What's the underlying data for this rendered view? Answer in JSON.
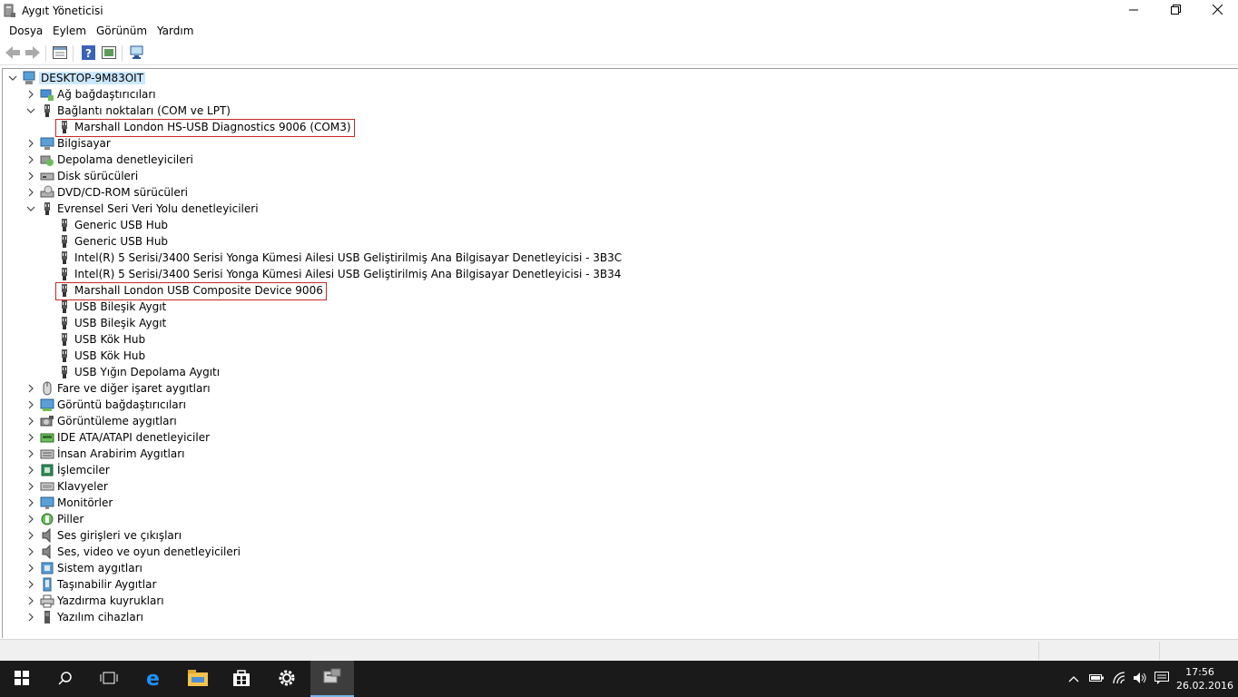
{
  "window": {
    "title": "Aygıt Yöneticisi",
    "controls": {
      "minimize": "minimize-icon",
      "maximize": "restore-icon",
      "close": "close-icon"
    }
  },
  "menu": {
    "items": [
      "Dosya",
      "Eylem",
      "Görünüm",
      "Yardım"
    ]
  },
  "toolbar": {
    "icons": [
      "back-arrow-icon",
      "forward-arrow-icon",
      "properties-icon",
      "help-icon",
      "update-driver-icon",
      "scan-hardware-icon"
    ]
  },
  "tree": {
    "root": "DESKTOP-9M83OIT",
    "rows": [
      {
        "label": "Ağ bağdaştırıcıları",
        "level": 1,
        "state": "collapsed",
        "icon": "network-adapter-icon"
      },
      {
        "label": "Bağlantı noktaları (COM ve LPT)",
        "level": 1,
        "state": "expanded",
        "icon": "port-icon"
      },
      {
        "label": "Marshall London HS-USB Diagnostics 9006 (COM3)",
        "level": 2,
        "state": "leaf",
        "icon": "port-icon",
        "highlighted": true
      },
      {
        "label": "Bilgisayar",
        "level": 1,
        "state": "collapsed",
        "icon": "computer-icon"
      },
      {
        "label": "Depolama denetleyicileri",
        "level": 1,
        "state": "collapsed",
        "icon": "storage-controller-icon"
      },
      {
        "label": "Disk sürücüleri",
        "level": 1,
        "state": "collapsed",
        "icon": "disk-drive-icon"
      },
      {
        "label": "DVD/CD-ROM sürücüleri",
        "level": 1,
        "state": "collapsed",
        "icon": "dvd-drive-icon"
      },
      {
        "label": "Evrensel Seri Veri Yolu denetleyicileri",
        "level": 1,
        "state": "expanded",
        "icon": "usb-icon"
      },
      {
        "label": "Generic USB Hub",
        "level": 2,
        "state": "leaf",
        "icon": "usb-icon"
      },
      {
        "label": "Generic USB Hub",
        "level": 2,
        "state": "leaf",
        "icon": "usb-icon"
      },
      {
        "label": "Intel(R) 5 Serisi/3400 Serisi Yonga Kümesi Ailesi USB Geliştirilmiş Ana Bilgisayar Denetleyicisi - 3B3C",
        "level": 2,
        "state": "leaf",
        "icon": "usb-icon"
      },
      {
        "label": "Intel(R) 5 Serisi/3400 Serisi Yonga Kümesi Ailesi USB Geliştirilmiş Ana Bilgisayar Denetleyicisi - 3B34",
        "level": 2,
        "state": "leaf",
        "icon": "usb-icon"
      },
      {
        "label": "Marshall London USB Composite Device 9006",
        "level": 2,
        "state": "leaf",
        "icon": "usb-icon",
        "highlighted": true
      },
      {
        "label": "USB Bileşik Aygıt",
        "level": 2,
        "state": "leaf",
        "icon": "usb-icon"
      },
      {
        "label": "USB Bileşik Aygıt",
        "level": 2,
        "state": "leaf",
        "icon": "usb-icon"
      },
      {
        "label": "USB Kök Hub",
        "level": 2,
        "state": "leaf",
        "icon": "usb-icon"
      },
      {
        "label": "USB Kök Hub",
        "level": 2,
        "state": "leaf",
        "icon": "usb-icon"
      },
      {
        "label": "USB Yığın Depolama Aygıtı",
        "level": 2,
        "state": "leaf",
        "icon": "usb-icon"
      },
      {
        "label": "Fare ve diğer işaret aygıtları",
        "level": 1,
        "state": "collapsed",
        "icon": "mouse-icon"
      },
      {
        "label": "Görüntü bağdaştırıcıları",
        "level": 1,
        "state": "collapsed",
        "icon": "display-adapter-icon"
      },
      {
        "label": "Görüntüleme aygıtları",
        "level": 1,
        "state": "collapsed",
        "icon": "imaging-device-icon"
      },
      {
        "label": "IDE ATA/ATAPI denetleyiciler",
        "level": 1,
        "state": "collapsed",
        "icon": "ide-controller-icon"
      },
      {
        "label": "İnsan Arabirim Aygıtları",
        "level": 1,
        "state": "collapsed",
        "icon": "hid-icon"
      },
      {
        "label": "İşlemciler",
        "level": 1,
        "state": "collapsed",
        "icon": "processor-icon"
      },
      {
        "label": "Klavyeler",
        "level": 1,
        "state": "collapsed",
        "icon": "keyboard-icon"
      },
      {
        "label": "Monitörler",
        "level": 1,
        "state": "collapsed",
        "icon": "monitor-icon"
      },
      {
        "label": "Piller",
        "level": 1,
        "state": "collapsed",
        "icon": "battery-icon"
      },
      {
        "label": "Ses girişleri ve çıkışları",
        "level": 1,
        "state": "collapsed",
        "icon": "speaker-icon"
      },
      {
        "label": "Ses, video ve oyun denetleyicileri",
        "level": 1,
        "state": "collapsed",
        "icon": "speaker-icon"
      },
      {
        "label": "Sistem aygıtları",
        "level": 1,
        "state": "collapsed",
        "icon": "system-device-icon"
      },
      {
        "label": "Taşınabilir Aygıtlar",
        "level": 1,
        "state": "collapsed",
        "icon": "portable-device-icon"
      },
      {
        "label": "Yazdırma kuyrukları",
        "level": 1,
        "state": "collapsed",
        "icon": "printer-icon"
      },
      {
        "label": "Yazılım cihazları",
        "level": 1,
        "state": "collapsed",
        "icon": "software-device-icon"
      }
    ]
  },
  "taskbar": {
    "apps": [
      "windows-start-icon",
      "search-icon",
      "task-view-icon",
      "edge-icon",
      "file-explorer-icon",
      "store-icon",
      "settings-icon",
      "device-manager-icon"
    ],
    "active_app": "device-manager-icon",
    "tray": [
      "chevron-up-icon",
      "battery-icon",
      "wifi-icon",
      "volume-icon",
      "action-center-icon"
    ],
    "time": "17:56",
    "date": "26.02.2016"
  },
  "colors": {
    "selection": "#cce8ff",
    "highlight_box": "#c62828",
    "taskbar": "#1a1a1a",
    "accent": "#0078d7"
  }
}
